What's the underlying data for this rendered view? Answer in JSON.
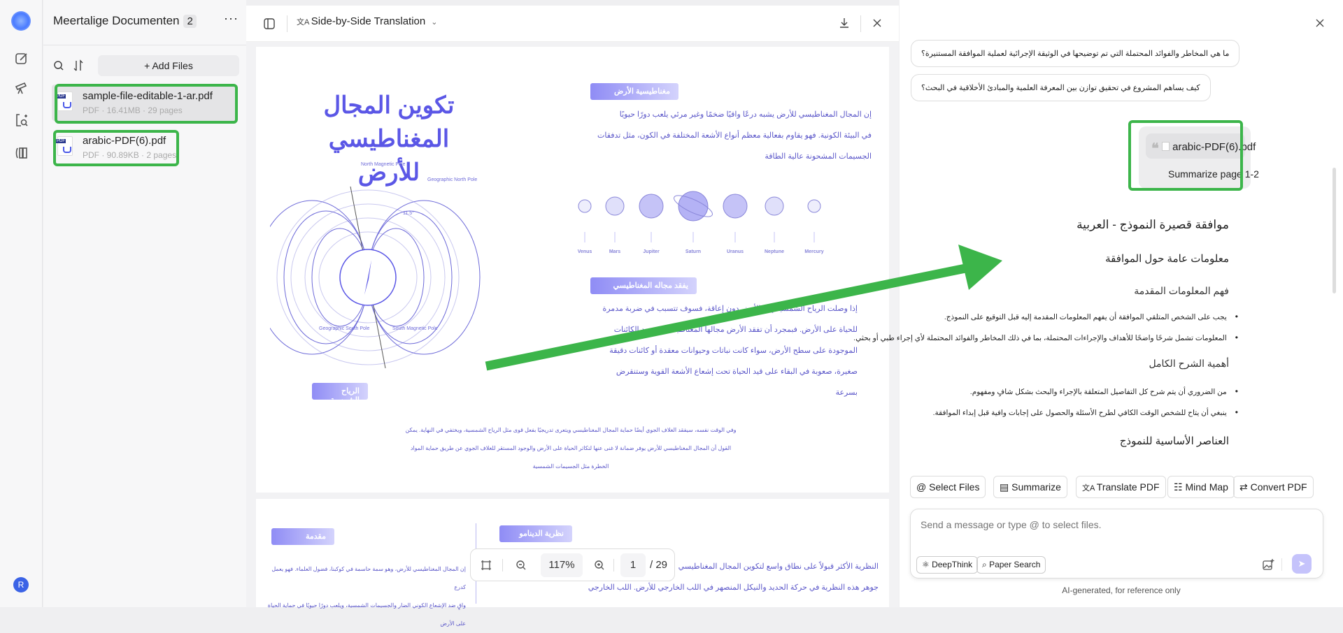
{
  "rail": {
    "icons": [
      "app-logo",
      "new-chat-icon",
      "telescope-icon",
      "search-document-icon",
      "library-icon"
    ],
    "avatar": "R"
  },
  "files": {
    "title": "Meertalige Documenten",
    "count": "2",
    "more": "···",
    "add_files": "+ Add Files",
    "items": [
      {
        "name": "sample-file-editable-1-ar.pdf",
        "meta": "PDF · 16.41MB · 29 pages",
        "selected": true
      },
      {
        "name": "arabic-PDF(6).pdf",
        "meta": "PDF · 90.89KB · 2 pages",
        "selected": false
      }
    ]
  },
  "viewer": {
    "mode": "Side-by-Side Translation",
    "zoom": "117%",
    "page": "1",
    "total": "/ 29",
    "page1": {
      "title": "تكوين المجال المغناطيسي للأرض",
      "tag1": "مغناطيسية الأرض",
      "text1": [
        "إن المجال المغناطيسي للأرض يشبه درعًا واقيًا ضخمًا وغير مرئي يلعب دورًا حيويًا",
        "في البيئة الكونية. فهو يقاوم بفعالية معظم أنواع الأشعة المختلفة في الكون، مثل تدفقات",
        "الجسيمات المشحونة عالية الطاقة"
      ],
      "planets": [
        "Venus",
        "Mars",
        "Jupiter",
        "Saturn",
        "Uranus",
        "Neptune",
        "Mercury"
      ],
      "diagram_labels": [
        "North Magnetic Pole",
        "Geographic North Pole",
        "Geographic South Pole",
        "South Magnetic Pole",
        "11.5°"
      ],
      "tag2": "يفقد مجاله المغناطيسي",
      "text2": [
        "إذا وصلت الرياح الشمسية إلى الأرض دون إعاقة، فسوف تتسبب في ضربة مدمرة",
        "للحياة على الأرض. فبمجرد أن تفقد الأرض مجالها المغناطيسي، ستجد الكائنات",
        "الموجودة على سطح الأرض، سواء كانت نباتات وحيوانات معقدة أو كائنات دقيقة",
        "صغيرة، صعوبة في البقاء على قيد الحياة تحت إشعاع الأشعة القوية وستنقرض",
        "بسرعة"
      ],
      "tag3": "الرياح الشمسية",
      "text3": [
        "وفي الوقت نفسه، سيفقد الغلاف الجوي أيضًا حماية المجال المغناطيسي ويتعرى تدريجيًا بفعل قوى مثل الرياح الشمسية، ويختفي في النهاية. يمكن",
        "القول أن المجال المغناطيسي للأرض يوفر ضمانة لا غنى عنها لتكاثر الحياة على الأرض والوجود المستقر للغلاف الجوي عن طريق حماية المواد",
        "الخطرة مثل الجسيمات الشمسية"
      ]
    },
    "page2": {
      "tag1": "مقدمة",
      "tag2": "نظرية الدينامو",
      "left": [
        "إن المجال المغناطيسي للأرض، وهو سمة حاسمة في كوكبنا، فضول العلماء. فهو يعمل كدرع",
        "واقٍ ضد الإشعاع الكوني الضار والجسيمات الشمسية، ويلعب دورًا حيويًا في حماية الحياة على الأرض"
      ],
      "right": [
        "النظرية الأكثر قبولاً على نطاق واسع لتكوين المجال المغناطيسي",
        "جوهر هذه النظرية في حركة الحديد والنيكل المنصهر في اللب الخارجي للأرض. اللب الخارجي"
      ]
    }
  },
  "chat": {
    "questions": [
      "ما هي المخاطر والفوائد المحتملة التي تم توضيحها في الوثيقة الإجرائية لعملية الموافقة المستنيرة؟",
      "كيف يساهم المشروع في تحقيق توازن بين المعرفة العلمية والمبادئ الأخلاقية في البحث؟"
    ],
    "user_file": "arabic-PDF(6).pdf",
    "user_text": "Summarize page 1-2",
    "answer": {
      "h1": "موافقة قصيرة النموذج - العربية",
      "h2a": "معلومات عامة حول الموافقة",
      "h3a": "فهم المعلومات المقدمة",
      "bullets_a": [
        "يجب على الشخص المتلقي الموافقة أن يفهم المعلومات المقدمة إليه قبل التوقيع على النموذج.",
        "المعلومات تشمل شرحًا واضحًا للأهداف والإجراءات المحتملة، بما في ذلك المخاطر والفوائد المحتملة لأي إجراء طبي أو بحثي."
      ],
      "h3b": "أهمية الشرح الكامل",
      "bullets_b": [
        "من الضروري أن يتم شرح كل التفاصيل المتعلقة بالإجراء والبحث بشكل شافٍ ومفهوم.",
        "ينبغي أن يتاح للشخص الوقت الكافي لطرح الأسئلة والحصول على إجابات وافية قبل إبداء الموافقة."
      ],
      "h2b": "العناصر الأساسية للنموذج"
    },
    "actions": [
      "Select Files",
      "Summarize",
      "Translate PDF",
      "Mind Map",
      "Convert PDF"
    ],
    "placeholder": "Send a message or type @ to select files.",
    "deepthink": "DeepThink",
    "paper_search": "Paper Search",
    "footer": "AI-generated, for reference only"
  },
  "colors": {
    "accent": "#5b57e6",
    "annotation": "#3cb54a",
    "send": "#c5c3fb"
  }
}
